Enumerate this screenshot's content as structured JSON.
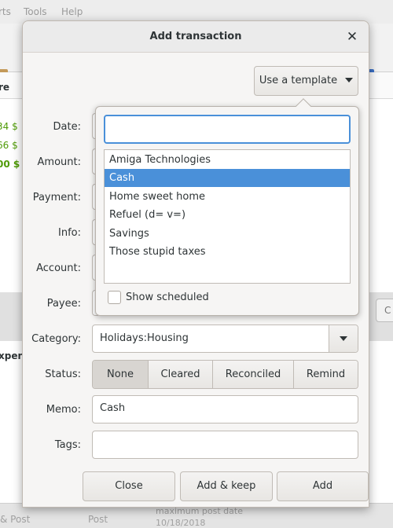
{
  "background": {
    "menu": [
      "rts",
      "Tools",
      "Help"
    ],
    "list_header": "re",
    "amounts": [
      "34 $",
      "66 $",
      "00 $"
    ],
    "lower_button_label": "C",
    "expense_header": "xpens",
    "status": {
      "add_post": "& Post",
      "post": "Post",
      "max_post_label": "maximum post date",
      "max_post_date": "10/18/2018"
    }
  },
  "dialog": {
    "title": "Add transaction",
    "template_button": "Use a template",
    "labels": {
      "date": "Date:",
      "amount": "Amount:",
      "payment": "Payment:",
      "info": "Info:",
      "account": "Account:",
      "payee": "Payee:",
      "category": "Category:",
      "status": "Status:",
      "memo": "Memo:",
      "tags": "Tags:"
    },
    "category_value": "Holidays:Housing",
    "status_options": [
      "None",
      "Cleared",
      "Reconciled",
      "Remind"
    ],
    "status_selected": "None",
    "memo_value": "Cash",
    "tags_value": "",
    "buttons": {
      "close": "Close",
      "add_keep": "Add & keep",
      "add": "Add"
    }
  },
  "template_popover": {
    "search_value": "",
    "items": [
      "Amiga Technologies",
      "Cash",
      "Home sweet home",
      "Refuel (d= v=)",
      "Savings",
      "Those stupid taxes"
    ],
    "selected": "Cash",
    "show_scheduled_label": "Show scheduled",
    "show_scheduled_checked": false
  },
  "colors": {
    "selection": "#4a90d9",
    "positive_amount": "#4e9a06"
  }
}
